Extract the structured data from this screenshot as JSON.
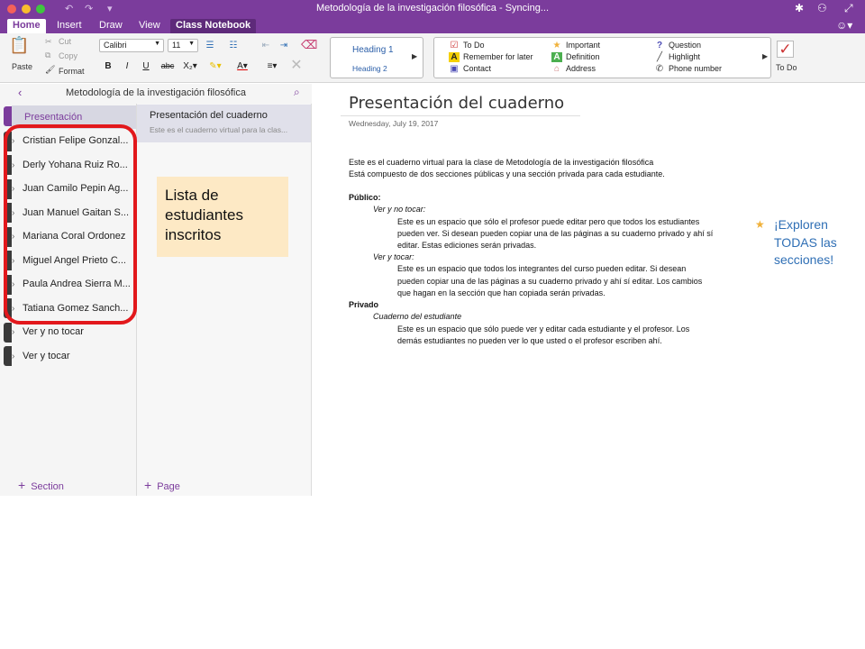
{
  "window": {
    "title": "Metodología de la investigación filosófica - Syncing..."
  },
  "tabs": [
    "Home",
    "Insert",
    "Draw",
    "View",
    "Class Notebook"
  ],
  "ribbon": {
    "paste": "Paste",
    "cut": "Cut",
    "copy": "Copy",
    "format": "Format",
    "font_name": "Calibri",
    "font_size": "11",
    "styles": [
      "Heading 1",
      "Heading 2"
    ],
    "tags": [
      {
        "icon": "checkbox-icon",
        "label": "To Do"
      },
      {
        "icon": "star-icon",
        "label": "Important"
      },
      {
        "icon": "question-icon",
        "label": "Question"
      },
      {
        "icon": "a-icon",
        "label": "Remember for later"
      },
      {
        "icon": "a-green-icon",
        "label": "Definition"
      },
      {
        "icon": "highlight-icon",
        "label": "Highlight"
      },
      {
        "icon": "contact-icon",
        "label": "Contact"
      },
      {
        "icon": "house-icon",
        "label": "Address"
      },
      {
        "icon": "phone-icon",
        "label": "Phone number"
      }
    ],
    "todo_label": "To Do"
  },
  "notebook": {
    "title": "Metodología de la investigación filosófica",
    "sections": [
      "Presentación",
      "Cristian Felipe Gonzal...",
      "Derly Yohana Ruiz Ro...",
      "Juan Camilo Pepin Ag...",
      "Juan Manuel Gaitan S...",
      "Mariana Coral Ordonez",
      "Miguel Angel Prieto C...",
      "Paula Andrea Sierra M...",
      "Tatiana Gomez Sanch...",
      "Ver y no tocar",
      "Ver y tocar"
    ],
    "add_section": "Section",
    "add_page": "Page",
    "selected_page": {
      "title": "Presentación del cuaderno",
      "preview": "Este es el cuaderno virtual para la clas..."
    }
  },
  "annotation": {
    "sticky_lines": [
      "Lista de",
      "estudiantes",
      "inscritos"
    ],
    "callout_lines": [
      "¡Exploren",
      "TODAS las",
      "secciones!"
    ]
  },
  "page": {
    "heading": "Presentación del cuaderno",
    "date": "Wednesday, July 19, 2017",
    "intro": [
      "Este es el cuaderno virtual para la clase de Metodología de la investigación filosófica",
      "Está compuesto de dos secciones públicas y una sección privada para cada estudiante."
    ],
    "publico_label": "Público:",
    "ver_no_tocar_label": "Ver y no tocar:",
    "ver_no_tocar_text": [
      "Este es un espacio que sólo el profesor puede editar pero que todos los estudiantes",
      "pueden ver. Si desean pueden copiar una de las páginas a su cuaderno privado y ahí sí",
      "editar. Estas ediciones serán privadas."
    ],
    "ver_tocar_label": "Ver y tocar:",
    "ver_tocar_text": [
      "Este es un espacio que todos los integrantes del curso pueden editar. Si desean",
      "pueden copiar una de las páginas a su cuaderno privado y ahí sí editar. Los cambios",
      "que hagan en la sección que han copiada serán privadas."
    ],
    "privado_label": "Privado",
    "cuaderno_label": "Cuaderno del estudiante",
    "cuaderno_text": [
      "Este es un espacio que sólo puede ver y editar cada estudiante y el profesor. Los",
      "demás estudiantes no pueden ver lo que usted o el profesor escriben ahí."
    ]
  }
}
